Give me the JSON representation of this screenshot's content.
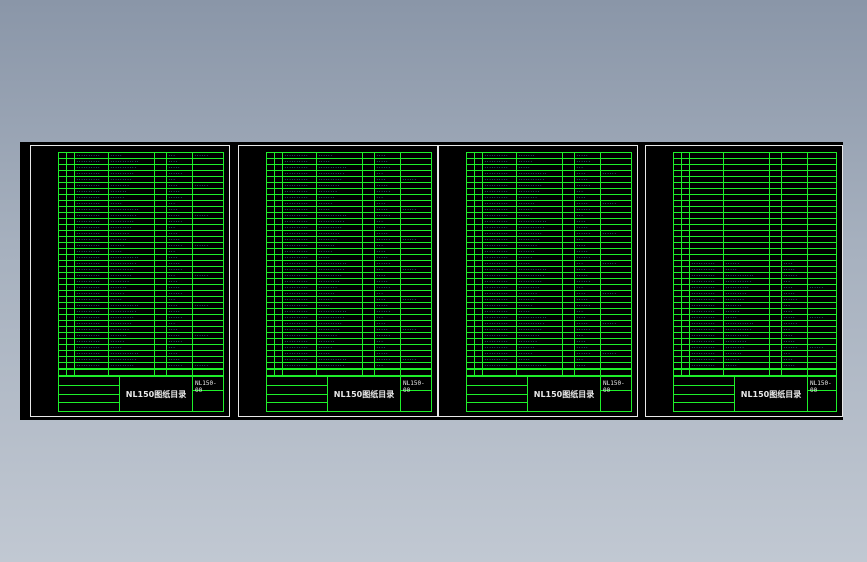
{
  "sheets": [
    {
      "title": "NL150图纸目录",
      "code": "NL150-00",
      "start": 25
    },
    {
      "title": "NL150图纸目录",
      "code": "NL150-00",
      "start": 89
    },
    {
      "title": "NL150图纸目录",
      "code": "NL150-00",
      "start": 153
    },
    {
      "title": "NL150图纸目录",
      "code": "NL150-00",
      "start": 217
    }
  ]
}
